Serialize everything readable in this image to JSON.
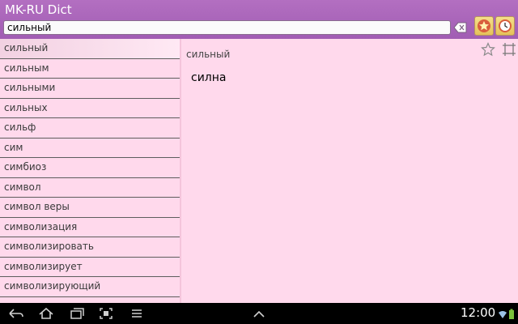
{
  "app": {
    "title": "MK-RU Dict"
  },
  "search": {
    "value": "сильный"
  },
  "list": {
    "items": [
      "сильный",
      "сильным",
      "сильными",
      "сильных",
      "сильф",
      "сим",
      "симбиоз",
      "символ",
      "символ веры",
      "символизация",
      "символизировать",
      "символизирует",
      "символизирующий"
    ],
    "selected_index": 0
  },
  "detail": {
    "header_word": "сильный",
    "translation": "силна"
  },
  "statusbar": {
    "time": "12:00"
  },
  "colors": {
    "titlebar": "#a967b9",
    "background": "#ffd9ec",
    "navbar": "#000000"
  },
  "icons": {
    "clear": "backspace-icon",
    "favorites": "star-icon",
    "history": "clock-icon",
    "favorite_toggle": "star-outline-icon",
    "expand": "fullscreen-icon",
    "nav_back": "back-icon",
    "nav_home": "home-icon",
    "nav_recents": "recent-apps-icon",
    "nav_screenshot": "screenshot-icon",
    "nav_menu": "menu-icon",
    "nav_up": "chevron-up-icon"
  }
}
